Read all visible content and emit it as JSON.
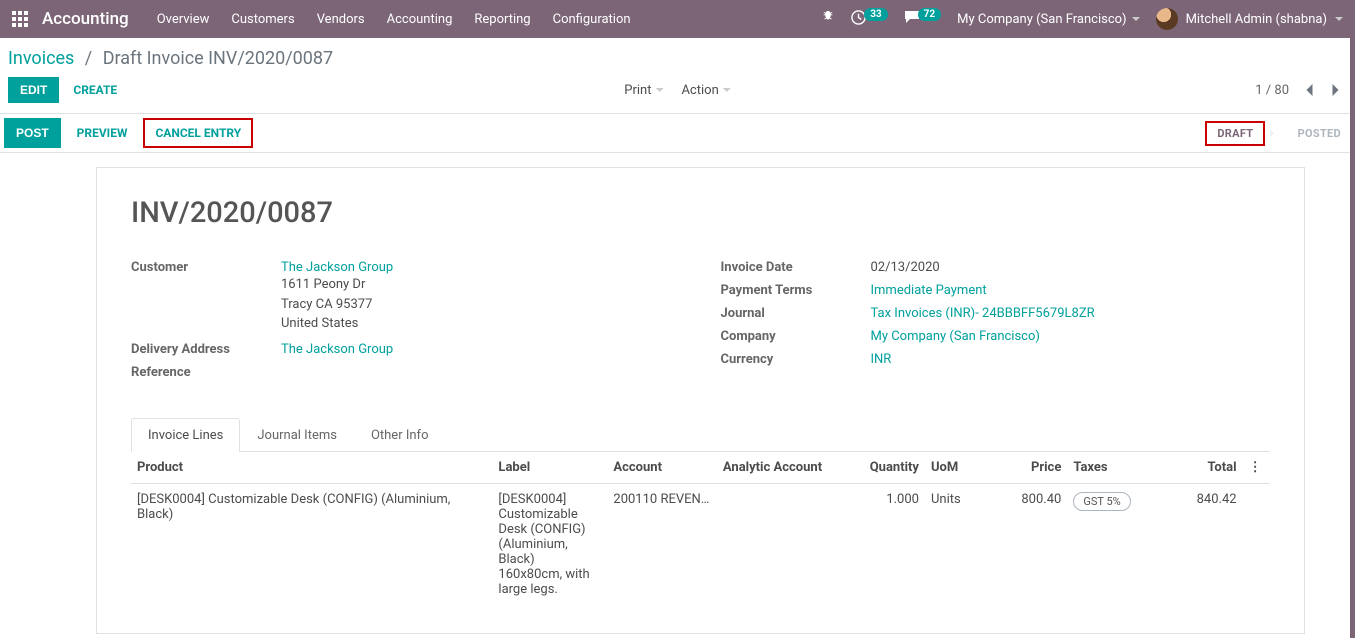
{
  "topnav": {
    "app_name": "Accounting",
    "menus": [
      "Overview",
      "Customers",
      "Vendors",
      "Accounting",
      "Reporting",
      "Configuration"
    ],
    "activity_count": "33",
    "message_count": "72",
    "company": "My Company (San Francisco)",
    "username": "Mitchell Admin (shabna)"
  },
  "breadcrumbs": {
    "root": "Invoices",
    "current": "Draft Invoice INV/2020/0087"
  },
  "controls": {
    "edit": "EDIT",
    "create": "CREATE",
    "print": "Print",
    "action": "Action",
    "pager": "1 / 80"
  },
  "statusbar": {
    "post": "POST",
    "preview": "PREVIEW",
    "cancel_entry": "CANCEL ENTRY",
    "draft": "DRAFT",
    "posted": "POSTED"
  },
  "doc": {
    "title": "INV/2020/0087",
    "left": {
      "customer_label": "Customer",
      "customer_name": "The Jackson Group",
      "addr1": "1611 Peony Dr",
      "addr2": "Tracy CA 95377",
      "addr3": "United States",
      "delivery_addr_label": "Delivery Address",
      "delivery_addr_value": "The Jackson Group",
      "reference_label": "Reference"
    },
    "right": {
      "invoice_date_label": "Invoice Date",
      "invoice_date_value": "02/13/2020",
      "payment_terms_label": "Payment Terms",
      "payment_terms_value": "Immediate Payment",
      "journal_label": "Journal",
      "journal_value": "Tax Invoices (INR)- 24BBBFF5679L8ZR",
      "company_label": "Company",
      "company_value": "My Company (San Francisco)",
      "currency_label": "Currency",
      "currency_value": "INR"
    }
  },
  "tabs": {
    "t1": "Invoice Lines",
    "t2": "Journal Items",
    "t3": "Other Info"
  },
  "table": {
    "h_product": "Product",
    "h_label": "Label",
    "h_account": "Account",
    "h_analytic": "Analytic Account",
    "h_qty": "Quantity",
    "h_uom": "UoM",
    "h_price": "Price",
    "h_taxes": "Taxes",
    "h_total": "Total",
    "row": {
      "product": "[DESK0004] Customizable Desk (CONFIG) (Aluminium, Black)",
      "label": "[DESK0004] Customizable Desk (CONFIG) (Aluminium, Black) 160x80cm, with large legs.",
      "account": "200110 REVEN…",
      "analytic": "",
      "qty": "1.000",
      "uom": "Units",
      "price": "800.40",
      "tax": "GST 5%",
      "total": "840.42"
    }
  }
}
